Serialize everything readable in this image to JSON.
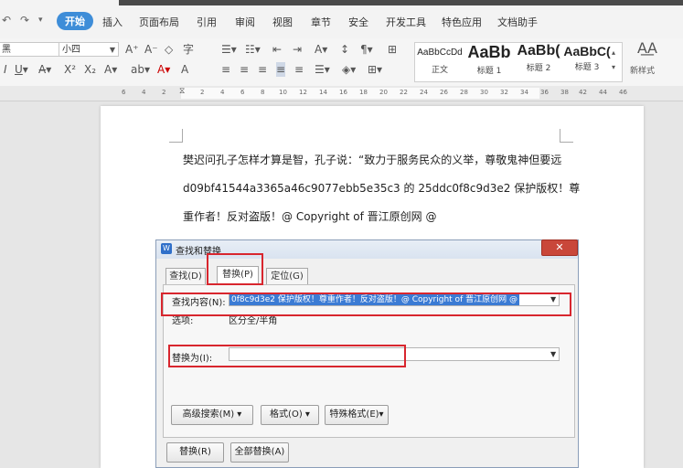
{
  "menu": {
    "tabs": [
      "开始",
      "插入",
      "页面布局",
      "引用",
      "审阅",
      "视图",
      "章节",
      "安全",
      "开发工具",
      "特色应用",
      "文档助手"
    ],
    "active_tab": "开始"
  },
  "ribbon": {
    "font_name": "黑",
    "font_size": "小四",
    "styles": [
      {
        "preview": "AaBbCcDd",
        "label": "正文"
      },
      {
        "preview": "AaBb",
        "label": "标题 1"
      },
      {
        "preview": "AaBb(",
        "label": "标题 2"
      },
      {
        "preview": "AaBbC(",
        "label": "标题 3"
      }
    ],
    "new_style_label": "新样式"
  },
  "ruler": {
    "ticks": [
      "6",
      "4",
      "2",
      "2",
      "4",
      "6",
      "8",
      "10",
      "12",
      "14",
      "16",
      "18",
      "20",
      "22",
      "24",
      "26",
      "28",
      "30",
      "32",
      "34",
      "36",
      "38",
      "40",
      "42",
      "44",
      "46"
    ]
  },
  "document": {
    "lines": [
      "樊迟问孔子怎样才算是智，孔子说：“致力于服务民众的义举，尊敬鬼神但要远",
      "d09bf41544a3365a46c9077ebb5e35c3 的 25ddc0f8c9d3e2 保护版权！尊",
      "重作者！反对盗版！@ Copyright of 晋江原创网 @"
    ]
  },
  "dialog": {
    "title": "查找和替换",
    "tabs": [
      "查找(D)",
      "替换(P)",
      "定位(G)"
    ],
    "active_tab": "替换(P)",
    "find_label": "查找内容(N):",
    "find_value": "0f8c9d3e2 保护版权！尊重作者！反对盗版！@ Copyright of 晋江原创网 @",
    "options_label": "选项:",
    "options_value": "区分全/半角",
    "replace_label": "替换为(I):",
    "replace_value": "",
    "buttons": {
      "advanced": "高级搜索(M)",
      "format": "格式(O)",
      "special": "特殊格式(E)",
      "replace": "替换(R)",
      "replace_all": "全部替换(A)"
    }
  },
  "colors": {
    "accent": "#3e8dd8",
    "highlight": "#d8262e",
    "selection": "#3b7bd4"
  }
}
